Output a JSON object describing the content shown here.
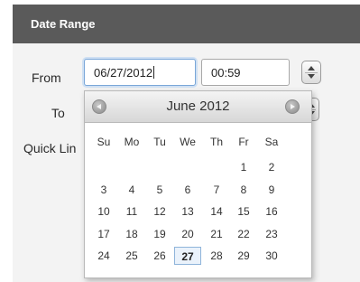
{
  "panel": {
    "title": "Date Range"
  },
  "form": {
    "from_label": "From",
    "to_label": "To",
    "quick_label": "Quick Lin",
    "from_date": "06/27/2012",
    "from_time": "00:59"
  },
  "calendar": {
    "month_title": "June 2012",
    "weekdays": [
      "Su",
      "Mo",
      "Tu",
      "We",
      "Th",
      "Fr",
      "Sa"
    ],
    "weeks": [
      [
        "",
        "",
        "",
        "",
        "",
        "1",
        "2"
      ],
      [
        "3",
        "4",
        "5",
        "6",
        "7",
        "8",
        "9"
      ],
      [
        "10",
        "11",
        "12",
        "13",
        "14",
        "15",
        "16"
      ],
      [
        "17",
        "18",
        "19",
        "20",
        "21",
        "22",
        "23"
      ],
      [
        "24",
        "25",
        "26",
        "27",
        "28",
        "29",
        "30"
      ]
    ],
    "selected_day": "27"
  }
}
